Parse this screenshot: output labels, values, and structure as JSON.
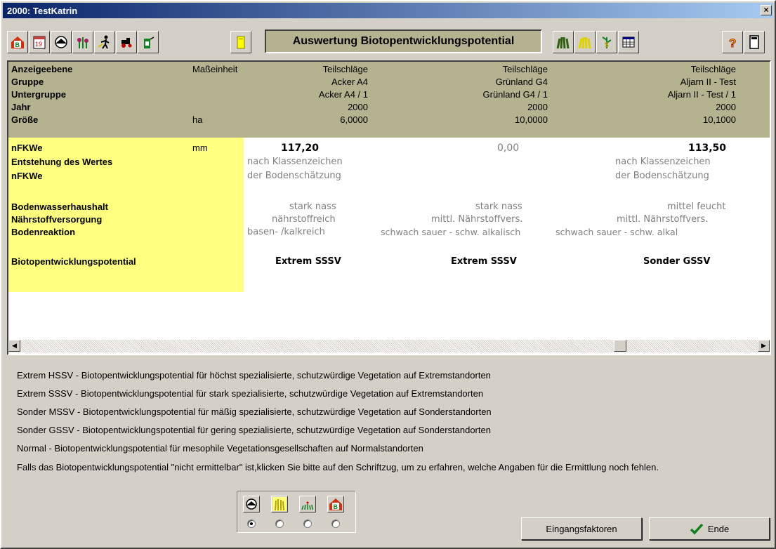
{
  "window": {
    "title": "2000: TestKatrin",
    "close_glyph": "×"
  },
  "toolbar": {
    "report_title": "Auswertung Biotopentwicklungspotential",
    "left_icons": [
      "home-b-icon",
      "calendar-icon",
      "soil-sample-icon",
      "plants-icon",
      "farmer-icon",
      "tractor-icon",
      "sprayer-icon",
      "note-icon"
    ],
    "right_icons": [
      "field-green-icon",
      "field-yellow-icon",
      "money-plant-icon",
      "table-icon",
      "help-icon",
      "calculator-icon"
    ]
  },
  "header": {
    "rows": [
      {
        "label": "Anzeigeebene",
        "unit": "Maßeinheit",
        "c1": "Teilschläge",
        "c2": "Teilschläge",
        "c3": "Teilschläge"
      },
      {
        "label": "Gruppe",
        "unit": "",
        "c1": "Acker A4",
        "c2": "Grünland G4",
        "c3": "Aljarn II - Test"
      },
      {
        "label": "Untergruppe",
        "unit": "",
        "c1": "Acker A4 / 1",
        "c2": "Grünland G4 / 1",
        "c3": "Aljarn II - Test / 1"
      },
      {
        "label": "Jahr",
        "unit": "",
        "c1": "2000",
        "c2": "2000",
        "c3": "2000"
      },
      {
        "label": "Größe",
        "unit": "ha",
        "c1": "6,0000",
        "c2": "10,0000",
        "c3": "10,1000"
      }
    ]
  },
  "data": {
    "nfkwe": {
      "label": "nFKWe",
      "unit": "mm",
      "c1": "117,20",
      "c2": "0,00",
      "c3": "113,50"
    },
    "entstehung": {
      "label": "Entstehung des Wertes",
      "c1": "nach Klassenzeichen",
      "c3": "nach Klassenzeichen"
    },
    "nfkwe2": {
      "label": "nFKWe",
      "c1": "der Bodenschätzung",
      "c3": "der Bodenschätzung"
    },
    "wasser": {
      "label": "Bodenwasserhaushalt",
      "c1": "stark nass",
      "c2": "stark nass",
      "c3": "mittel feucht"
    },
    "naehr": {
      "label": "Nährstoffversorgung",
      "c1": "nährstoffreich",
      "c2": "mittl. Nährstoffvers.",
      "c3": "mittl. Nährstoffvers."
    },
    "reaktion": {
      "label": "Bodenreaktion",
      "c1": "basen- /kalkreich",
      "c2": "schwach sauer - schw. alkalisch",
      "c3": "schwach sauer - schw. alkal"
    },
    "potential": {
      "label": "Biotopentwicklungspotential",
      "c1": "Extrem SSSV",
      "c2": "Extrem SSSV",
      "c3": "Sonder GSSV"
    }
  },
  "legend": [
    "Extrem HSSV - Biotopentwicklungspotential für höchst spezialisierte, schutzwürdige Vegetation auf Extremstandorten",
    "Extrem SSSV - Biotopentwicklungspotential für stark spezialisierte, schutzwürdige Vegetation auf Extremstandorten",
    "Sonder MSSV - Biotopentwicklungspotential für mäßig spezialisierte, schutzwürdige Vegetation auf Sonderstandorten",
    "Sonder GSSV - Biotopentwicklungspotential für gering spezialisierte, schutzwürdige Vegetation auf Sonderstandorten",
    "Normal - Biotopentwicklungspotential für mesophile Vegetationsgesellschaften auf Normalstandorten"
  ],
  "hint": "Falls das Biotopentwicklungspotential \"nicht ermittelbar\" ist,klicken Sie bitte auf den Schriftzug, um zu erfahren, welche Angaben für die Ermittlung noch fehlen.",
  "view_selector": {
    "selected_index": 0,
    "icons": [
      "soil-sample-icon",
      "grain-icon",
      "meadow-icon",
      "home-b-icon"
    ]
  },
  "buttons": {
    "eingangsfaktoren": "Eingangsfaktoren",
    "ende": "Ende"
  }
}
